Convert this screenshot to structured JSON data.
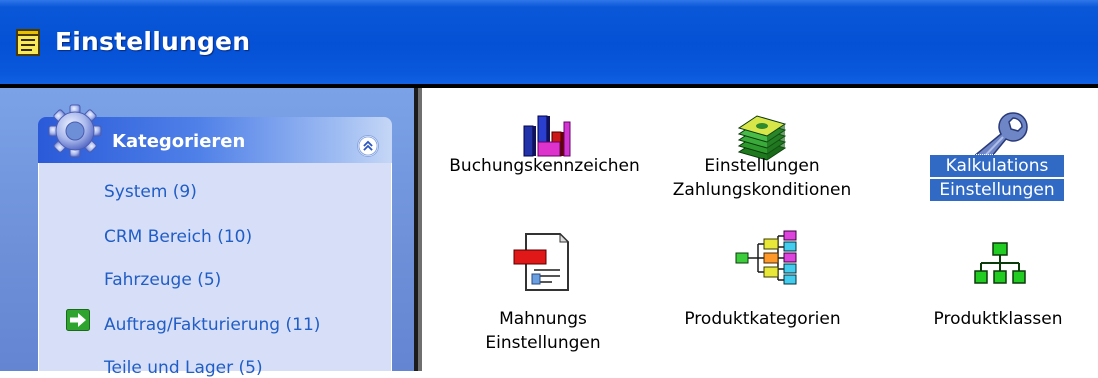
{
  "window": {
    "title": "Einstellungen",
    "title_icon": "notepad-icon",
    "colors": {
      "titlebar": "#0551d6",
      "sidebar": "#7ba2e7",
      "panel_body": "#d6dff7",
      "link": "#215dc6",
      "selection": "#316ac5"
    }
  },
  "sidebar": {
    "panel_title": "Kategorieren",
    "panel_icon": "gear-icon",
    "collapse_icon": "chevron-double-up-icon",
    "items": [
      {
        "label": "System (9)"
      },
      {
        "label": "CRM Bereich (10)"
      },
      {
        "label": "Fahrzeuge (5)"
      },
      {
        "label": "Auftrag/Fakturierung (11)",
        "icon": "green-arrow-icon",
        "active": true
      },
      {
        "label": "Teile und Lager (5)"
      }
    ]
  },
  "content": {
    "items": [
      {
        "line1": "Buchungskennzeichen",
        "line2": "",
        "icon": "bar-chart-icon"
      },
      {
        "line1": "Einstellungen",
        "line2": "Zahlungskonditionen",
        "icon": "money-stack-icon"
      },
      {
        "line1": "Kalkulations",
        "line2": "Einstellungen",
        "icon": "wrench-icon",
        "selected": true
      },
      {
        "line1": "Mahnungs",
        "line2": "Einstellungen",
        "icon": "document-icon"
      },
      {
        "line1": "Produktkategorien",
        "line2": "",
        "icon": "hierarchy-tree-icon"
      },
      {
        "line1": "Produktklassen",
        "line2": "",
        "icon": "org-chart-icon"
      }
    ]
  }
}
